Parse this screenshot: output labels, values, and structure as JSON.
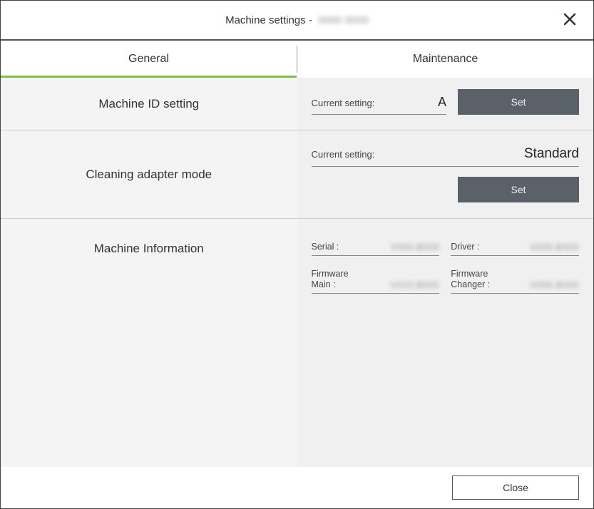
{
  "title": {
    "prefix": "Machine settings -",
    "suffix": "0000 0000"
  },
  "tabs": {
    "general": "General",
    "maintenance": "Maintenance"
  },
  "sections": {
    "machine_id": {
      "label": "Machine ID setting",
      "current_label": "Current setting:",
      "current_value": "A",
      "set_btn": "Set"
    },
    "cleaning": {
      "label": "Cleaning adapter mode",
      "current_label": "Current setting:",
      "current_value": "Standard",
      "set_btn": "Set"
    },
    "info": {
      "label": "Machine Information",
      "serial_label": "Serial :",
      "serial_value": "V000.B000",
      "driver_label": "Driver :",
      "driver_value": "V000.B000",
      "fw_main_label": "Firmware\nMain :",
      "fw_main_value": "V010.B000",
      "fw_changer_label": "Firmware\nChanger :",
      "fw_changer_value": "V000.B000"
    }
  },
  "footer": {
    "close": "Close"
  }
}
